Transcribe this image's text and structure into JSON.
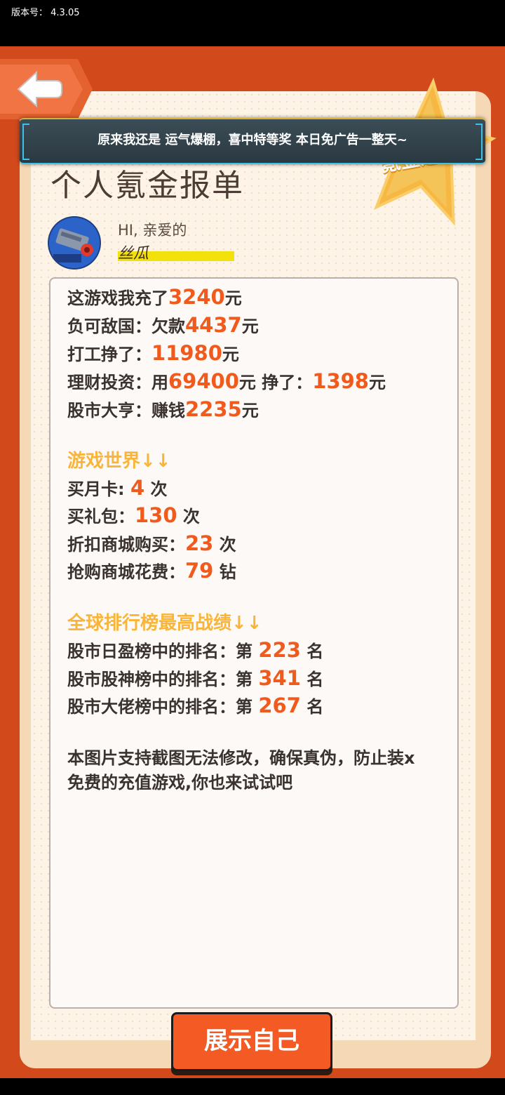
{
  "status": {
    "version_label": "版本号：",
    "version_value": "4.3.05"
  },
  "banner": {
    "text": "原来我还是 运气爆棚，喜中特等奖 本日免广告一整天~"
  },
  "badge": {
    "text": "氪金之王"
  },
  "report": {
    "title": "个人氪金报单",
    "greeting": "HI, 亲爱的",
    "username": "丝瓜",
    "finance": [
      {
        "parts": [
          "这游戏我充了",
          "3240",
          "元"
        ]
      },
      {
        "parts": [
          "负可敌国：欠款",
          "4437",
          "元"
        ]
      },
      {
        "parts": [
          "打工挣了：",
          "11980",
          "元"
        ]
      },
      {
        "parts": [
          "理财投资：用",
          "69400",
          "元 挣了：",
          "1398",
          "元"
        ]
      },
      {
        "parts": [
          "股市大亨：赚钱",
          "2235",
          "元"
        ]
      }
    ],
    "game_world_heading": "游戏世界↓↓",
    "game_world": [
      {
        "label": "买月卡: ",
        "value": "4",
        "unit": " 次"
      },
      {
        "label": "买礼包：",
        "value": "130",
        "unit": " 次"
      },
      {
        "label": "折扣商城购买：",
        "value": "23",
        "unit": " 次"
      },
      {
        "label": "抢购商城花费：",
        "value": "79",
        "unit": " 钻"
      }
    ],
    "ranking_heading": "全球排行榜最高战绩↓↓",
    "rankings": [
      {
        "label": "股市日盈榜中的排名：第 ",
        "value": "223",
        "unit": " 名"
      },
      {
        "label": "股市股神榜中的排名：第 ",
        "value": "341",
        "unit": " 名"
      },
      {
        "label": "股市大佬榜中的排名：第 ",
        "value": "267",
        "unit": " 名"
      }
    ],
    "note_line1": "本图片支持截图无法修改，确保真伪，防止装x",
    "note_line2": "免费的充值游戏,你也来试试吧"
  },
  "actions": {
    "show_self": "展示自己"
  },
  "colors": {
    "accent": "#f05a1c",
    "heading": "#f9b53a",
    "background": "#d2491c"
  },
  "icons": {
    "back": "back-arrow-icon",
    "avatar": "cannon-avatar-icon"
  }
}
